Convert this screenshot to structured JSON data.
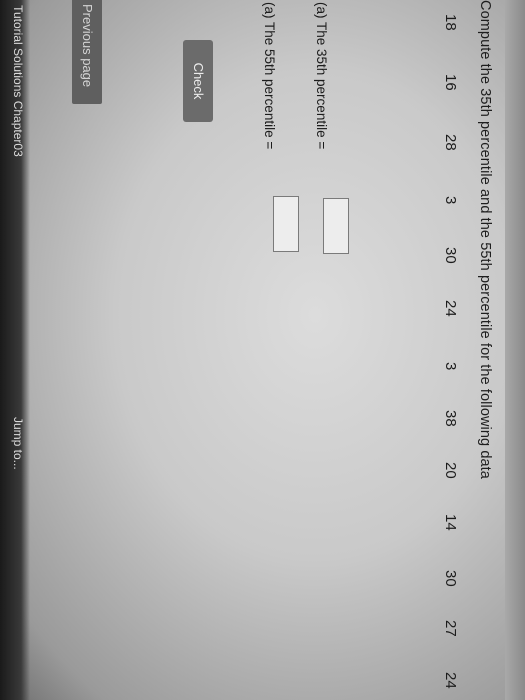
{
  "question": {
    "prompt": "Compute the 35th percentile and the 55th percentile for the following data",
    "data_values": [
      "18",
      "16",
      "28",
      "3",
      "30",
      "24",
      "3",
      "38",
      "20",
      "14",
      "30",
      "27",
      "24"
    ]
  },
  "answers": [
    {
      "label": "(a) The 35th percentile =",
      "value": ""
    },
    {
      "label": "(a) The 55th percentile =",
      "value": ""
    }
  ],
  "buttons": {
    "check": "Check",
    "previous_page": "Previous page"
  },
  "footer": {
    "left_text": "← Tutorial Solutions Chapter03",
    "right_text": "Jump to..."
  }
}
